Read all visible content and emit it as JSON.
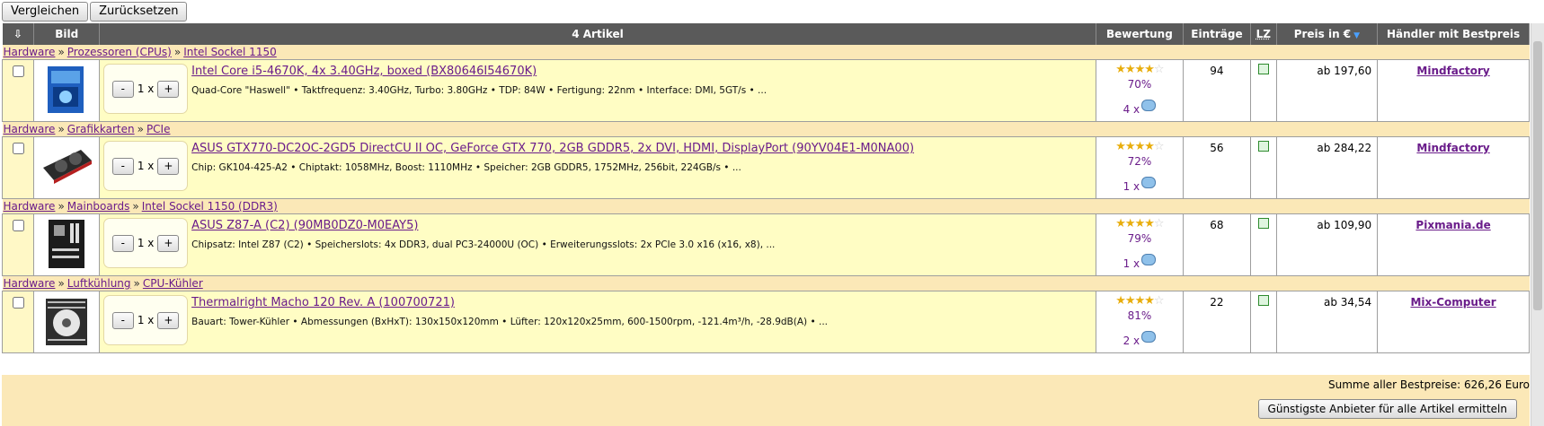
{
  "toolbar": {
    "compare_label": "Vergleichen",
    "reset_label": "Zurücksetzen"
  },
  "header": {
    "col_image": "Bild",
    "col_count": "4 Artikel",
    "col_rating": "Bewertung",
    "col_entries": "Einträge",
    "col_lz": "LZ",
    "col_price": "Preis in €",
    "col_dealer": "Händler mit Bestpreis"
  },
  "items": [
    {
      "breadcrumb": [
        "Hardware",
        "Prozessoren (CPUs)",
        "Intel Sockel 1150"
      ],
      "qty": "1 x",
      "title": "Intel Core i5-4670K, 4x 3.40GHz, boxed (BX80646I54670K)",
      "desc": "Quad-Core \"Haswell\" • Taktfrequenz: 3.40GHz, Turbo: 3.80GHz • TDP: 84W • Fertigung: 22nm • Interface: DMI, 5GT/s • ...",
      "rating": 4,
      "rating_pct": "70%",
      "reviews": "4 x",
      "entries": "94",
      "price": "ab 197,60",
      "dealer": "Mindfactory",
      "image": "cpu-box"
    },
    {
      "breadcrumb": [
        "Hardware",
        "Grafikkarten",
        "PCIe"
      ],
      "qty": "1 x",
      "title": "ASUS GTX770-DC2OC-2GD5 DirectCU II OC, GeForce GTX 770, 2GB GDDR5, 2x DVI, HDMI, DisplayPort (90YV04E1-M0NA00)",
      "desc": "Chip: GK104-425-A2 • Chiptakt: 1058MHz, Boost: 1110MHz • Speicher: 2GB GDDR5, 1752MHz, 256bit, 224GB/s • ...",
      "rating": 4,
      "rating_pct": "72%",
      "reviews": "1 x",
      "entries": "56",
      "price": "ab 284,22",
      "dealer": "Mindfactory",
      "image": "gpu"
    },
    {
      "breadcrumb": [
        "Hardware",
        "Mainboards",
        "Intel Sockel 1150 (DDR3)"
      ],
      "qty": "1 x",
      "title": "ASUS Z87-A (C2) (90MB0DZ0-M0EAY5)",
      "desc": "Chipsatz: Intel Z87 (C2) • Speicherslots: 4x DDR3, dual PC3-24000U (OC) • Erweiterungsslots: 2x PCIe 3.0 x16 (x16, x8), ...",
      "rating": 4,
      "rating_pct": "79%",
      "reviews": "1 x",
      "entries": "68",
      "price": "ab 109,90",
      "dealer": "Pixmania.de",
      "image": "mainboard"
    },
    {
      "breadcrumb": [
        "Hardware",
        "Luftkühlung",
        "CPU-Kühler"
      ],
      "qty": "1 x",
      "title": "Thermalright Macho 120 Rev. A (100700721)",
      "desc": "Bauart: Tower-Kühler • Abmessungen (BxHxT): 130x150x120mm • Lüfter: 120x120x25mm, 600-1500rpm, -121.4m³/h, -28.9dB(A) • ...",
      "rating": 4,
      "rating_pct": "81%",
      "reviews": "2 x",
      "entries": "22",
      "price": "ab 34,54",
      "dealer": "Mix-Computer",
      "image": "cooler"
    }
  ],
  "footer": {
    "sum_text": "Summe aller Bestpreise: 626,26 Euro",
    "cheapest_label": "Günstigste Anbieter für alle Artikel ermitteln"
  },
  "icons": {
    "sort_arrow": "green-down-arrow-icon",
    "review": "speech-bubble-icon"
  }
}
